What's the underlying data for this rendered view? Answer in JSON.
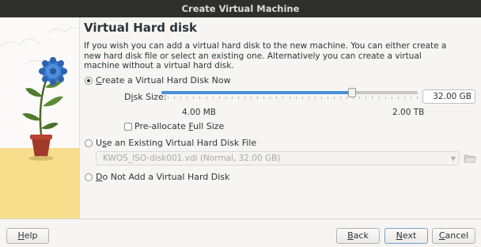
{
  "window": {
    "title": "Create Virtual Machine"
  },
  "page": {
    "heading": "Virtual Hard disk",
    "description": "If you wish you can add a virtual hard disk to the new machine. You can either create a new hard disk file or select an existing one. Alternatively you can create a virtual machine without a virtual hard disk."
  },
  "options": {
    "create_now": {
      "pre": "",
      "mnemonic": "C",
      "post": "reate a Virtual Hard Disk Now",
      "checked": true
    },
    "use_existing": {
      "pre": "U",
      "mnemonic": "s",
      "post": "e an Existing Virtual Hard Disk File",
      "checked": false
    },
    "no_disk": {
      "pre": "",
      "mnemonic": "D",
      "post": "o Not Add a Virtual Hard Disk",
      "checked": false
    }
  },
  "disk": {
    "size_label_pre": "D",
    "size_label_mnemonic": "i",
    "size_label_post": "sk Size:",
    "size_value": "32.00 GB",
    "slider_fraction": 0.743,
    "min_label": "4.00 MB",
    "max_label": "2.00 TB",
    "preallocate_pre": "Pre-allocate ",
    "preallocate_mnemonic": "F",
    "preallocate_post": "ull Size",
    "preallocate_checked": false
  },
  "existing": {
    "selected_file": "KWOS_ISO-disk001.vdi (Normal, 32.00 GB)"
  },
  "buttons": {
    "help": {
      "mnemonic": "H",
      "post": "elp"
    },
    "back": {
      "mnemonic": "B",
      "post": "ack"
    },
    "next": {
      "mnemonic": "N",
      "post": "ext"
    },
    "cancel": {
      "mnemonic": "C",
      "post": "ancel"
    }
  },
  "colors": {
    "slider_fill": "#4a90d9",
    "slider_track": "#c8c6c2",
    "titlebar": "#2f2f2c",
    "panel_floor": "#f7dd8c"
  },
  "icons": {
    "titlebar_close": "close-icon",
    "folder_button": "folder-open-icon",
    "combo_arrow": "chevron-down-icon"
  }
}
